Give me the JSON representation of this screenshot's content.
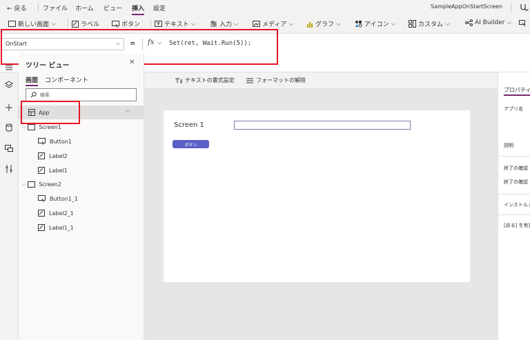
{
  "menubar": {
    "back": "← 戻る",
    "items": [
      "ファイル",
      "ホーム",
      "ビュー",
      "挿入",
      "設定"
    ],
    "active": "挿入",
    "app_name": "SampleAppOnStartScreen"
  },
  "ribbon": {
    "items": [
      {
        "label": "新しい画面",
        "icon": "new-screen-icon"
      },
      {
        "label": "ラベル",
        "icon": "label-icon"
      },
      {
        "label": "ボタン",
        "icon": "button-icon"
      },
      {
        "label": "テキスト",
        "icon": "text-icon"
      },
      {
        "label": "入力",
        "icon": "input-icon"
      },
      {
        "label": "メディア",
        "icon": "media-icon"
      },
      {
        "label": "グラフ",
        "icon": "chart-icon"
      },
      {
        "label": "アイコン",
        "icon": "icons-icon"
      },
      {
        "label": "カスタム",
        "icon": "custom-icon"
      },
      {
        "label": "AI Builder",
        "icon": "ai-builder-icon"
      }
    ]
  },
  "formulabar": {
    "property": "OnStart",
    "equals": "=",
    "fx": "fx",
    "formula": "Set(ret, Wait.Run(5));"
  },
  "tree": {
    "title": "ツリー ビュー",
    "tabs": [
      "画面",
      "コンポーネント"
    ],
    "search_placeholder": "検索",
    "items": [
      {
        "label": "App",
        "level": 0,
        "icon": "app-icon",
        "selected": true
      },
      {
        "label": "Screen1",
        "level": 0,
        "icon": "screen-icon",
        "expanded": true
      },
      {
        "label": "Button1",
        "level": 1,
        "icon": "button-icon"
      },
      {
        "label": "Label2",
        "level": 1,
        "icon": "label-icon"
      },
      {
        "label": "Label1",
        "level": 1,
        "icon": "label-icon"
      },
      {
        "label": "Screen2",
        "level": 0,
        "icon": "screen-icon",
        "expanded": true
      },
      {
        "label": "Button1_1",
        "level": 1,
        "icon": "button-icon"
      },
      {
        "label": "Label2_1",
        "level": 1,
        "icon": "label-icon"
      },
      {
        "label": "Label1_1",
        "level": 1,
        "icon": "label-icon"
      }
    ],
    "more": "···"
  },
  "format_bar": {
    "text_format": "テキストの書式設定",
    "clear_format": "フォーマットの解除"
  },
  "screen": {
    "label": "Screen 1",
    "button": "ボタン"
  },
  "props": {
    "header": "プロパティ",
    "labels": [
      "アプリ名",
      "説明",
      "終了の確認",
      "終了の確認",
      "インストルメン",
      "[戻る] を有効"
    ]
  },
  "colors": {
    "accent": "#742774",
    "highlight": "#e81123",
    "button": "#5b5fc7"
  }
}
